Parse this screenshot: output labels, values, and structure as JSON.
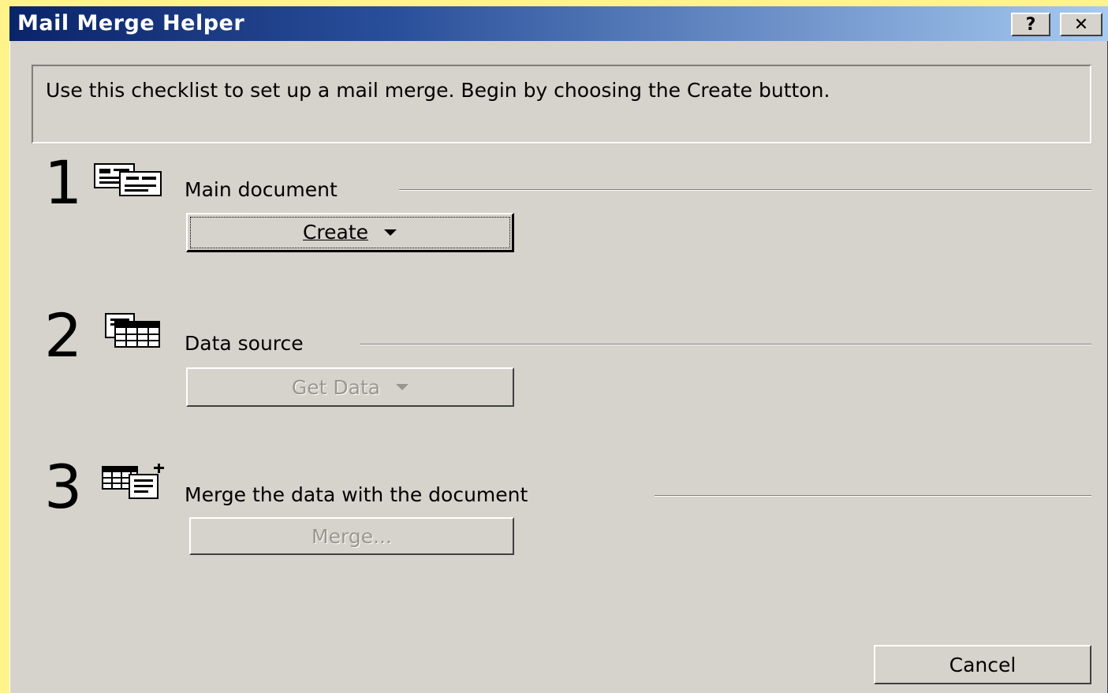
{
  "window": {
    "title": "Mail Merge Helper",
    "help_label": "?",
    "close_label": "✕"
  },
  "instruction": "Use this checklist to set up a mail merge. Begin by choosing the Create button.",
  "steps": [
    {
      "number": "1",
      "label": "Main document",
      "button": "Create",
      "icon": "main-document-icon",
      "enabled": true
    },
    {
      "number": "2",
      "label": "Data source",
      "button": "Get Data",
      "icon": "data-source-icon",
      "enabled": false
    },
    {
      "number": "3",
      "label": "Merge the data with the document",
      "button": "Merge...",
      "icon": "merge-icon",
      "enabled": false
    }
  ],
  "cancel_label": "Cancel",
  "colors": {
    "dialog_bg": "#d6d2cc",
    "titlebar_start": "#0a246a",
    "titlebar_end": "#a6caf0",
    "page_bg": "#fff38a"
  }
}
